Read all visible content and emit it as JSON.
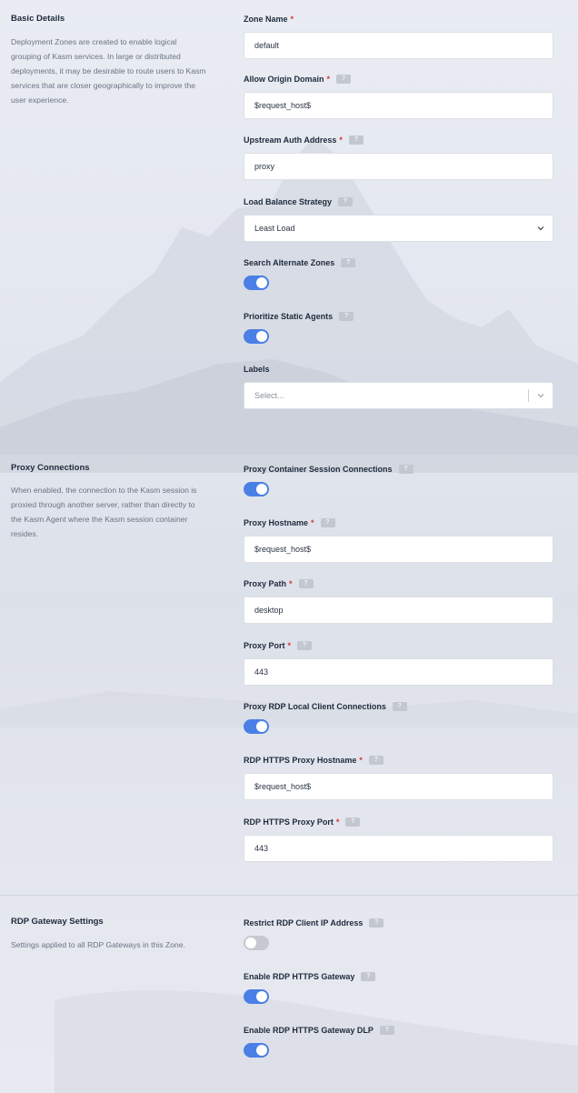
{
  "basic_details": {
    "title": "Basic Details",
    "description": "Deployment Zones are created to enable logical grouping of Kasm services. In large or distributed deployments, it may be desirable to route users to Kasm services that are closer geographically to improve the user experience.",
    "zone_name": {
      "label": "Zone Name",
      "value": "default"
    },
    "allow_origin_domain": {
      "label": "Allow Origin Domain",
      "value": "$request_host$"
    },
    "upstream_auth_address": {
      "label": "Upstream Auth Address",
      "value": "proxy"
    },
    "load_balance_strategy": {
      "label": "Load Balance Strategy",
      "value": "Least Load"
    },
    "search_alternate_zones": {
      "label": "Search Alternate Zones",
      "enabled": true
    },
    "prioritize_static_agents": {
      "label": "Prioritize Static Agents",
      "enabled": true
    },
    "labels": {
      "label": "Labels",
      "placeholder": "Select..."
    }
  },
  "proxy_connections": {
    "title": "Proxy Connections",
    "description": "When enabled, the connection to the Kasm session is proxied through another server, rather than directly to the Kasm Agent where the Kasm session container resides.",
    "proxy_container_session_connections": {
      "label": "Proxy Container Session Connections",
      "enabled": true
    },
    "proxy_hostname": {
      "label": "Proxy Hostname",
      "value": "$request_host$"
    },
    "proxy_path": {
      "label": "Proxy Path",
      "value": "desktop"
    },
    "proxy_port": {
      "label": "Proxy Port",
      "value": "443"
    },
    "proxy_rdp_local_client_connections": {
      "label": "Proxy RDP Local Client Connections",
      "enabled": true
    },
    "rdp_https_proxy_hostname": {
      "label": "RDP HTTPS Proxy Hostname",
      "value": "$request_host$"
    },
    "rdp_https_proxy_port": {
      "label": "RDP HTTPS Proxy Port",
      "value": "443"
    }
  },
  "rdp_gateway_settings": {
    "title": "RDP Gateway Settings",
    "description": "Settings applied to all RDP Gateways in this Zone.",
    "restrict_rdp_client_ip_address": {
      "label": "Restrict RDP Client IP Address",
      "enabled": false
    },
    "enable_rdp_https_gateway": {
      "label": "Enable RDP HTTPS Gateway",
      "enabled": true
    },
    "enable_rdp_https_gateway_dlp": {
      "label": "Enable RDP HTTPS Gateway DLP",
      "enabled": true
    }
  },
  "common": {
    "required_mark": "*",
    "help_mark": "?"
  },
  "colors": {
    "accent": "#4a7fe6",
    "required": "#d23a3a",
    "toggle_off": "#c6c9cf"
  }
}
